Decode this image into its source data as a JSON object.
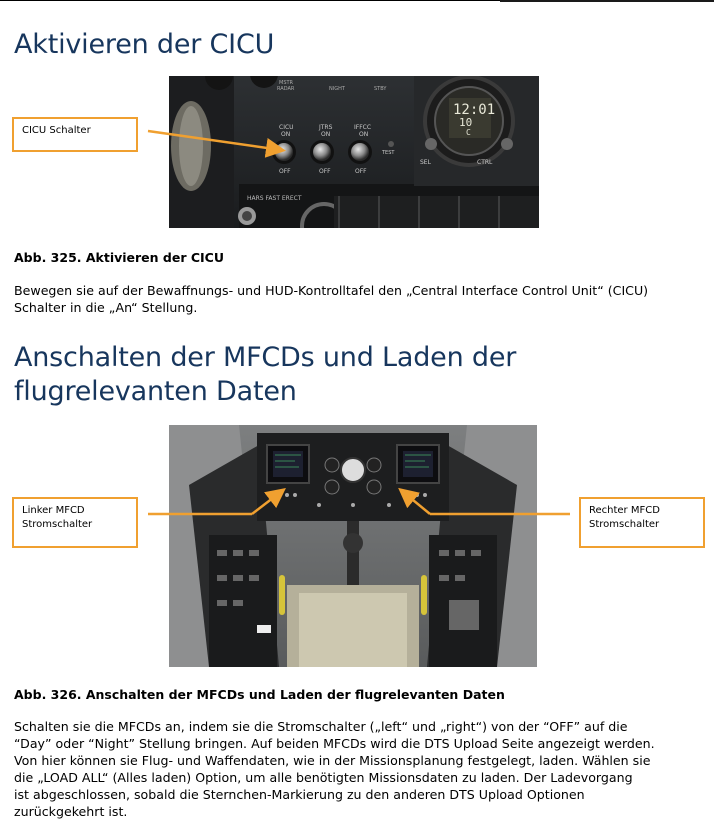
{
  "section1": {
    "title": "Aktivieren der CICU",
    "callout": "CICU Schalter",
    "panel_labels": {
      "cicu": "CICU",
      "jtrs": "JTRS",
      "iffcc": "IFFCC",
      "on": "ON",
      "off": "OFF",
      "test": "TEST",
      "sel": "SEL",
      "ctrl": "CTRL",
      "harness": "HARS FAST ERECT",
      "clock_top": "12:01",
      "clock_mid": "10",
      "clock_bot": "C"
    },
    "caption": "Abb. 325. Aktivieren der CICU",
    "paragraph_lines": [
      "Bewegen sie auf der Bewaffnungs- und HUD-Kontrolltafel den „Central Interface Control Unit“ (CICU)",
      "Schalter in die „An“ Stellung."
    ]
  },
  "section2": {
    "title_lines": [
      "Anschalten der MFCDs und Laden der",
      "flugrelevanten Daten"
    ],
    "callout_left_lines": [
      "Linker MFCD",
      "Stromschalter"
    ],
    "callout_right_lines": [
      "Rechter MFCD",
      "Stromschalter"
    ],
    "caption": "Abb. 326. Anschalten der MFCDs und Laden der flugrelevanten Daten",
    "paragraph_lines": [
      "Schalten sie die MFCDs an, indem sie die Stromschalter („left“ und „right“) von der “OFF” auf die",
      "“Day” oder “Night” Stellung bringen. Auf beiden MFCDs wird die DTS Upload Seite angezeigt werden.",
      "Von hier können sie Flug- und Waffendaten, wie in der Missionsplanung festgelegt, laden. Wählen sie",
      "die „LOAD ALL“ (Alles laden) Option, um alle benötigten Missionsdaten zu laden.  Der Ladevorgang",
      "ist abgeschlossen, sobald die Sternchen-Markierung zu den anderen DTS Upload Optionen",
      "zurückgekehrt ist."
    ]
  },
  "colors": {
    "heading": "#17365d",
    "callout_border": "#f0a030",
    "arrow": "#f0a030"
  }
}
